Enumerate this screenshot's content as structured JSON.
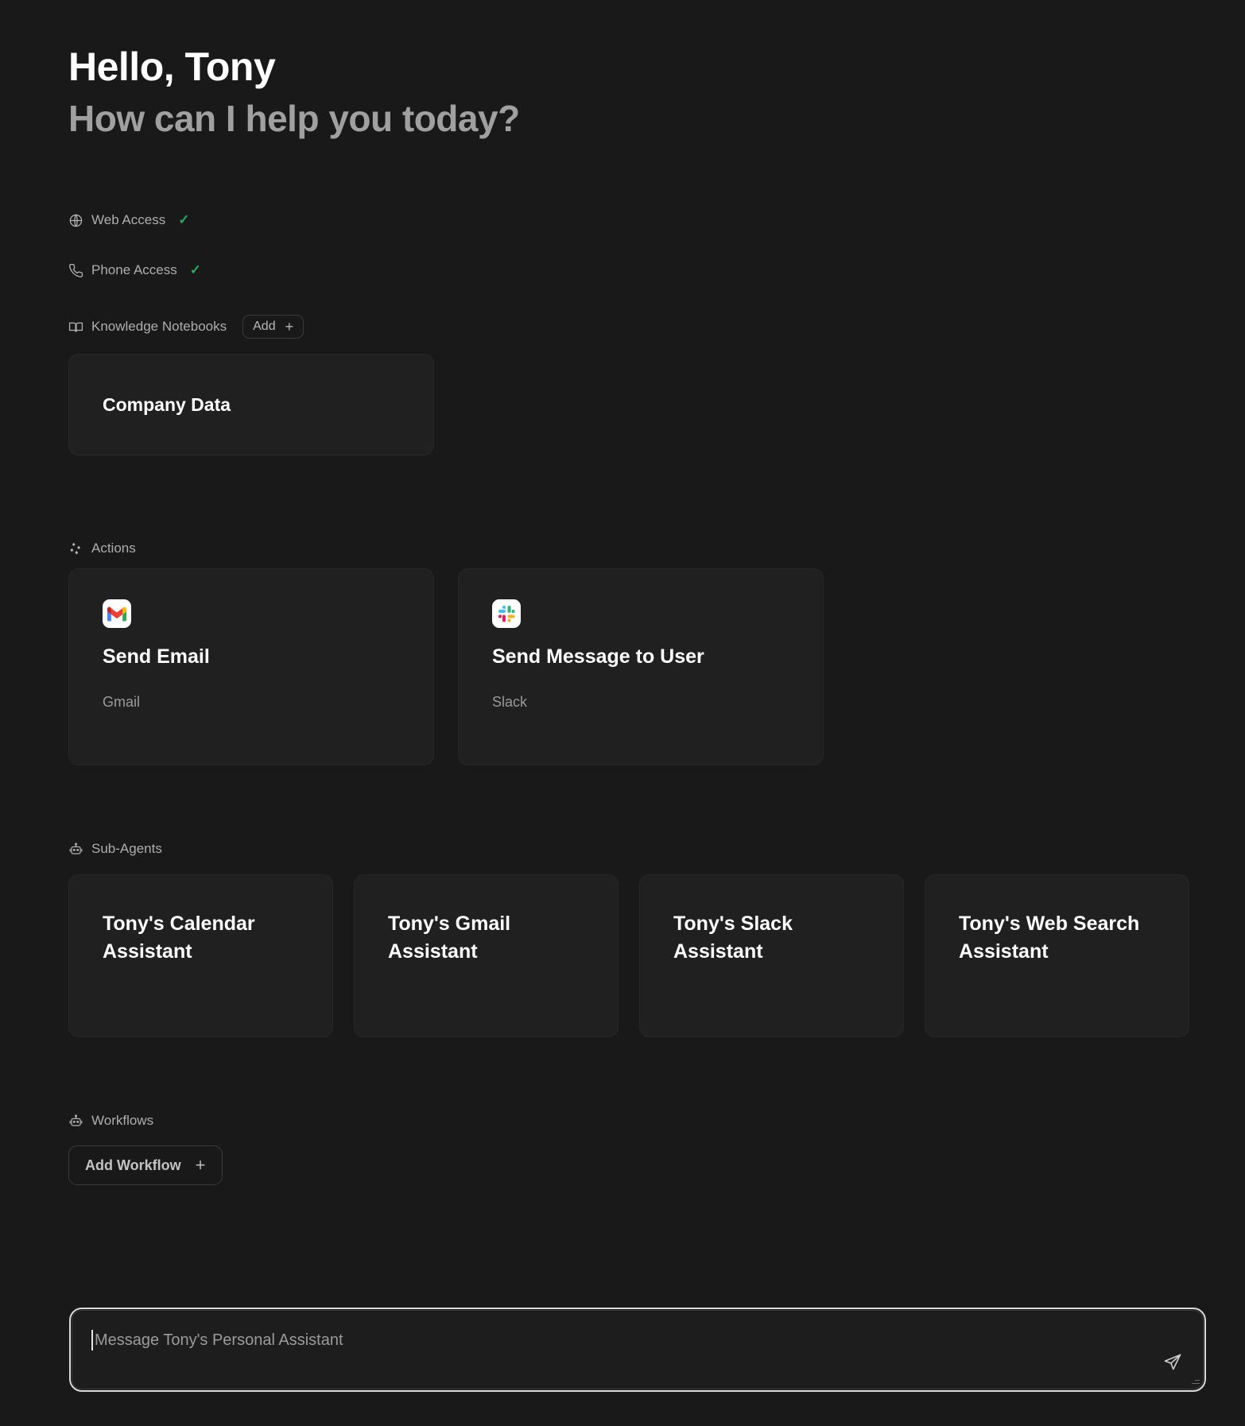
{
  "greeting": {
    "line1": "Hello, Tony",
    "line2": "How can I help you today?"
  },
  "capabilities": [
    {
      "label": "Web Access",
      "icon": "globe-icon",
      "enabled_mark": "✓"
    },
    {
      "label": "Phone Access",
      "icon": "phone-icon",
      "enabled_mark": "✓"
    }
  ],
  "knowledge_notebooks": {
    "label": "Knowledge Notebooks",
    "icon": "book-icon",
    "add_label": "Add",
    "add_plus": "+",
    "items": [
      {
        "title": "Company Data"
      }
    ]
  },
  "actions": {
    "label": "Actions",
    "icon": "sparkle-diamonds-icon",
    "items": [
      {
        "title": "Send Email",
        "app": "Gmail",
        "icon": "gmail-icon"
      },
      {
        "title": "Send Message to User",
        "app": "Slack",
        "icon": "slack-icon"
      }
    ]
  },
  "sub_agents": {
    "label": "Sub-Agents",
    "icon": "robot-icon",
    "items": [
      {
        "title": "Tony's Calendar Assistant"
      },
      {
        "title": "Tony's Gmail Assistant"
      },
      {
        "title": "Tony's Slack Assistant"
      },
      {
        "title": "Tony's Web Search Assistant"
      }
    ]
  },
  "workflows": {
    "label": "Workflows",
    "icon": "robot-icon",
    "add_label": "Add Workflow",
    "add_plus": "+"
  },
  "composer": {
    "placeholder": "Message Tony's Personal Assistant",
    "value": "",
    "send_icon": "send-paper-plane-icon"
  },
  "colors": {
    "background": "#191919",
    "card": "#202020",
    "card_border": "#272727",
    "text_primary": "#ffffff",
    "text_secondary": "#a0a0a0",
    "accent_check": "#2ea85c",
    "focus_ring": "#d9d9d9"
  }
}
